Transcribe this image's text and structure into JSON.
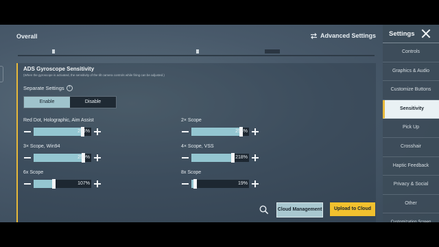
{
  "header": {
    "title": "Overall",
    "advanced_label": "Advanced Settings"
  },
  "card": {
    "title": "ADS Gyroscope Sensitivity",
    "note": "(When the gyroscope is activated, the sensitivity of the tilt camera controls while firing can be adjusted.)",
    "separate_label": "Separate Settings",
    "help_glyph": "?",
    "toggle": {
      "enable": "Enable",
      "disable": "Disable",
      "selected": "Enable"
    }
  },
  "sliders": [
    {
      "label": "Red Dot, Holographic, Aim Assist",
      "value": "256%",
      "fraction": 0.85
    },
    {
      "label": "2× Scope",
      "value": "258%",
      "fraction": 0.86
    },
    {
      "label": "3× Scope, Win94",
      "value": "259%",
      "fraction": 0.86
    },
    {
      "label": "4× Scope, VSS",
      "value": "218%",
      "fraction": 0.72
    },
    {
      "label": "6x Scope",
      "value": "107%",
      "fraction": 0.35
    },
    {
      "label": "8x Scope",
      "value": "19%",
      "fraction": 0.06
    }
  ],
  "bottom": {
    "cloud_management": "Cloud Management",
    "upload": "Upload to Cloud"
  },
  "sidebar": {
    "title": "Settings",
    "items": [
      {
        "label": "Controls",
        "active": false
      },
      {
        "label": "Graphics & Audio",
        "active": false
      },
      {
        "label": "Customize Buttons",
        "active": false
      },
      {
        "label": "Sensitivity",
        "active": true
      },
      {
        "label": "Pick Up",
        "active": false
      },
      {
        "label": "Crosshair",
        "active": false
      },
      {
        "label": "Haptic Feedback",
        "active": false
      },
      {
        "label": "Privacy & Social",
        "active": false
      },
      {
        "label": "Other",
        "active": false
      },
      {
        "label": "Customization Screen",
        "active": false
      }
    ]
  },
  "colors": {
    "accent": "#e8b93a",
    "slider_fill": "#94c6d1",
    "upload_button": "#f2c12e"
  }
}
